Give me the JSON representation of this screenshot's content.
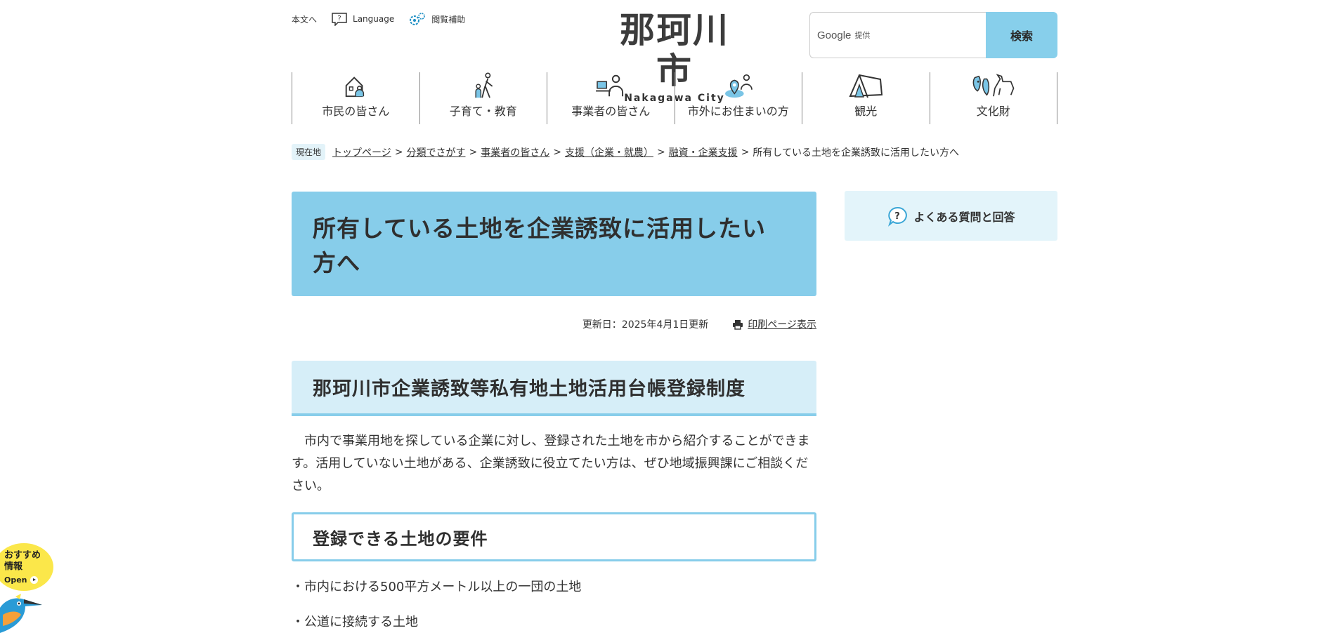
{
  "utility": {
    "skip": "本文へ",
    "language": "Language",
    "accessibility": "閲覧補助"
  },
  "logo": {
    "kanji": "那珂川市",
    "english": "Nakagawa City"
  },
  "search": {
    "provider": "Google",
    "provided": "提供",
    "button": "検索"
  },
  "nav": {
    "items": [
      {
        "label": "市民の皆さん",
        "icon": "house-person-icon"
      },
      {
        "label": "子育て・教育",
        "icon": "parent-child-icon"
      },
      {
        "label": "事業者の皆さん",
        "icon": "business-person-icon"
      },
      {
        "label": "市外にお住まいの方",
        "icon": "location-person-icon"
      },
      {
        "label": "観光",
        "icon": "tent-icon"
      },
      {
        "label": "文化財",
        "icon": "haniwa-icon"
      }
    ]
  },
  "breadcrumb": {
    "here": "現在地",
    "items": [
      "トップページ",
      "分類でさがす",
      "事業者の皆さん",
      "支援（企業・就農）",
      "融資・企業支援"
    ],
    "current": "所有している土地を企業誘致に活用したい方へ"
  },
  "page": {
    "title_line1": "所有している土地を企業誘致に活用したい",
    "title_line2": "方へ",
    "updated": "更新日：2025年4月1日更新",
    "print": "印刷ページ表示",
    "h2": "那珂川市企業誘致等私有地土地活用台帳登録制度",
    "paragraph": "　市内で事業用地を探している企業に対し、登録された土地を市から紹介することができます。活用していない土地がある、企業誘致に役立てたい方は、ぜひ地域振興課にご相談ください。",
    "h3": "登録できる土地の要件",
    "bullets": [
      "・市内における500平方メートル以上の一団の土地",
      "・公道に接続する土地"
    ]
  },
  "side": {
    "faq": "よくある質問と回答"
  },
  "widget": {
    "line1": "おすすめ",
    "line2": "情報",
    "open": "Open"
  },
  "colors": {
    "accent": "#87cdea",
    "light": "#d6eef8",
    "widget": "#fbe74a"
  }
}
